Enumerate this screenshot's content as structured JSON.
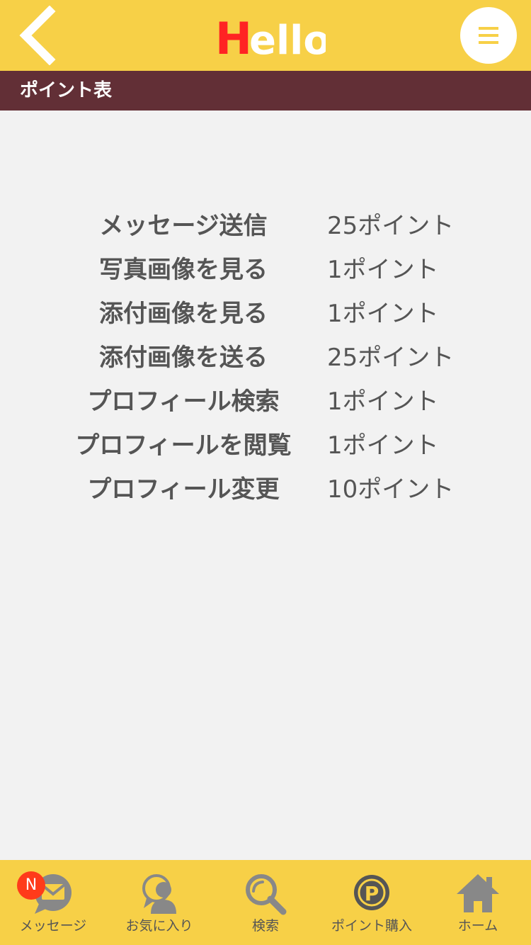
{
  "header": {
    "logo_text": "Hello",
    "menu_icon": "hamburger-icon",
    "back_icon": "chevron-left-icon"
  },
  "page_title": "ポイント表",
  "points_table": [
    {
      "action": "メッセージ送信",
      "points": "25ポイント"
    },
    {
      "action": "写真画像を見る",
      "points": "1ポイント"
    },
    {
      "action": "添付画像を見る",
      "points": "1ポイント"
    },
    {
      "action": "添付画像を送る",
      "points": "25ポイント"
    },
    {
      "action": "プロフィール検索",
      "points": "1ポイント"
    },
    {
      "action": "プロフィールを閲覧",
      "points": "1ポイント"
    },
    {
      "action": "プロフィール変更",
      "points": "10ポイント"
    }
  ],
  "tabbar": {
    "items": [
      {
        "label": "メッセージ",
        "icon": "message-icon",
        "badge": "N"
      },
      {
        "label": "お気に入り",
        "icon": "favorites-icon"
      },
      {
        "label": "検索",
        "icon": "search-icon"
      },
      {
        "label": "ポイント購入",
        "icon": "point-coin-icon"
      },
      {
        "label": "ホーム",
        "icon": "home-icon"
      }
    ]
  },
  "colors": {
    "header_bg": "#f7d047",
    "title_bar_bg": "#622f36",
    "page_bg": "#f2f2f2",
    "text": "#555555",
    "badge": "#ff3b1a",
    "logo_h": "#ff2323",
    "logo_rest": "#ffffff"
  }
}
